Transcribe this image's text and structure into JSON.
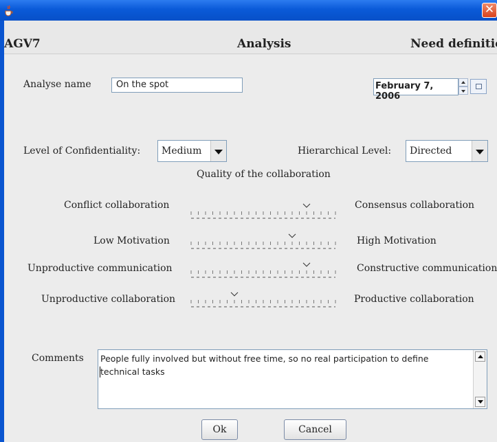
{
  "window": {
    "icon": "java-cup-icon",
    "close_icon": "close-icon",
    "close_glyph": "✕"
  },
  "header": {
    "project": "AGV7",
    "section": "Analysis",
    "status": "Need definitio"
  },
  "form": {
    "analyse_name_label": "Analyse name",
    "analyse_name_value": "On the spot",
    "date_value": "February 7, 2006",
    "confidentiality_label": "Level of Confidentiality:",
    "confidentiality_value": "Medium",
    "hierarchical_label": "Hierarchical Level:",
    "hierarchical_value": "Directed"
  },
  "quality": {
    "title": "Quality of the collaboration",
    "sliders": [
      {
        "left_label": "Conflict collaboration",
        "right_label": "Consensus collaboration",
        "value": 0.8
      },
      {
        "left_label": "Low Motivation",
        "right_label": "High Motivation",
        "value": 0.7
      },
      {
        "left_label": "Unproductive communication",
        "right_label": "Constructive communication",
        "value": 0.8
      },
      {
        "left_label": "Unproductive collaboration",
        "right_label": "Productive collaboration",
        "value": 0.3
      }
    ]
  },
  "comments": {
    "label": "Comments",
    "text_line1": "People fully involved but without free time, so no real participation to define",
    "text_line2": "technical tasks"
  },
  "buttons": {
    "ok": "Ok",
    "cancel": "Cancel"
  },
  "colors": {
    "titlebar": "#0a5ad8",
    "close": "#d8421c",
    "field_border": "#7f9db9"
  }
}
